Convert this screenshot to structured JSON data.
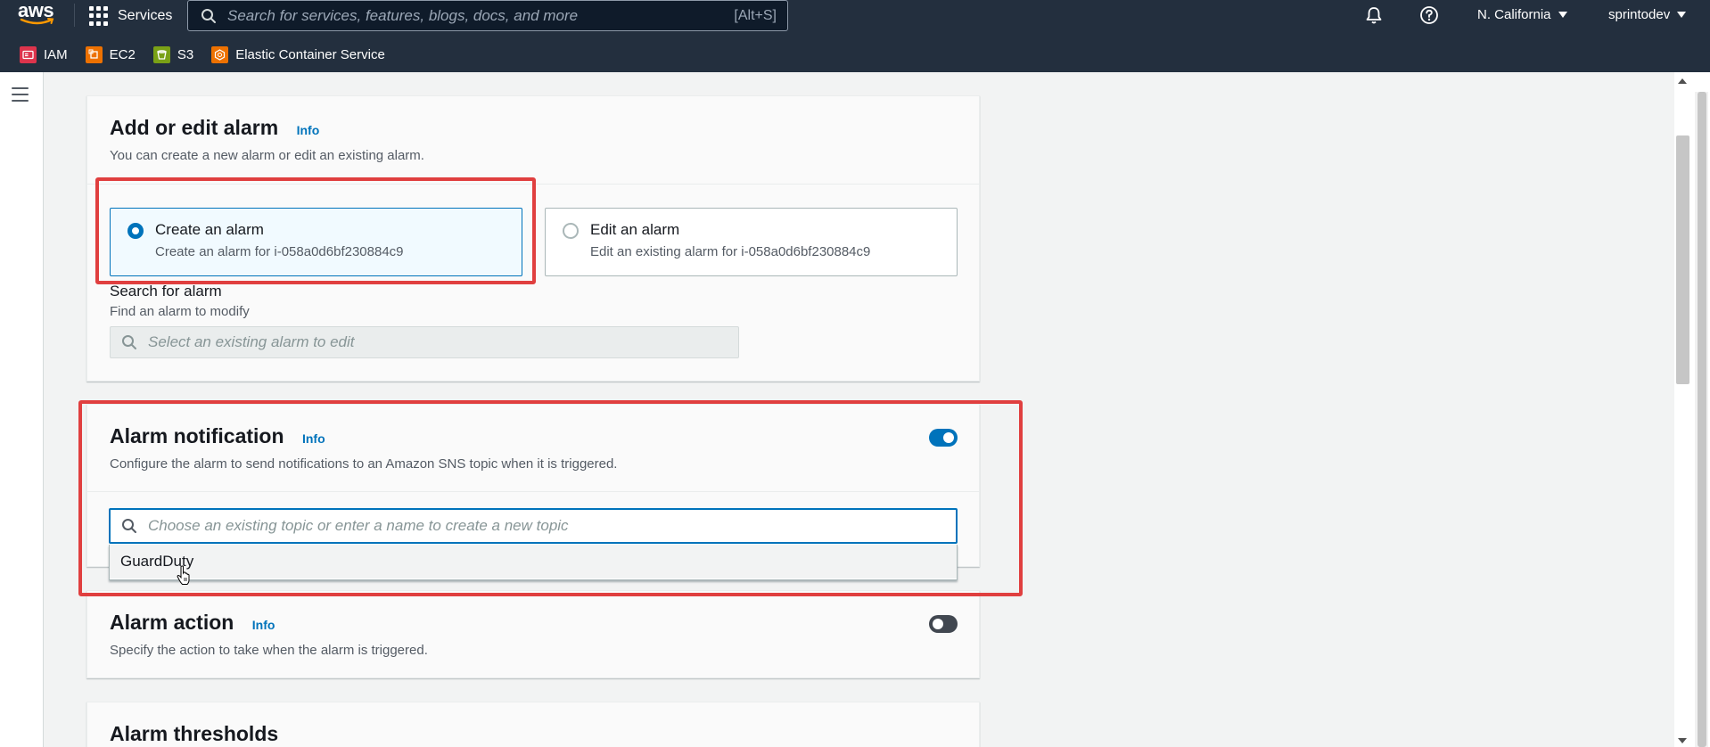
{
  "nav": {
    "logo": "aws",
    "services_label": "Services",
    "search_placeholder": "Search for services, features, blogs, docs, and more",
    "search_shortcut": "[Alt+S]",
    "region": "N. California",
    "account": "sprintodev",
    "favorites": [
      {
        "label": "IAM",
        "color": "#dd344c"
      },
      {
        "label": "EC2",
        "color": "#ed7100"
      },
      {
        "label": "S3",
        "color": "#7aa116"
      },
      {
        "label": "Elastic Container Service",
        "color": "#ed7100"
      }
    ]
  },
  "add_edit": {
    "title": "Add or edit alarm",
    "info": "Info",
    "description": "You can create a new alarm or edit an existing alarm.",
    "options": [
      {
        "title": "Create an alarm",
        "subtitle": "Create an alarm for i-058a0d6bf230884c9",
        "selected": true
      },
      {
        "title": "Edit an alarm",
        "subtitle": "Edit an existing alarm for i-058a0d6bf230884c9",
        "selected": false
      }
    ],
    "search_label": "Search for alarm",
    "search_sub": "Find an alarm to modify",
    "search_placeholder": "Select an existing alarm to edit"
  },
  "notification": {
    "title": "Alarm notification",
    "info": "Info",
    "description": "Configure the alarm to send notifications to an Amazon SNS topic when it is triggered.",
    "enabled": true,
    "topic_placeholder": "Choose an existing topic or enter a name to create a new topic",
    "dropdown_options": [
      "GuardDuty"
    ]
  },
  "action": {
    "title": "Alarm action",
    "info": "Info",
    "description": "Specify the action to take when the alarm is triggered.",
    "enabled": false
  },
  "thresholds": {
    "title": "Alarm thresholds"
  },
  "colors": {
    "nav_bg": "#232f3e",
    "accent": "#0073bb",
    "annotation": "#e03f3f"
  }
}
